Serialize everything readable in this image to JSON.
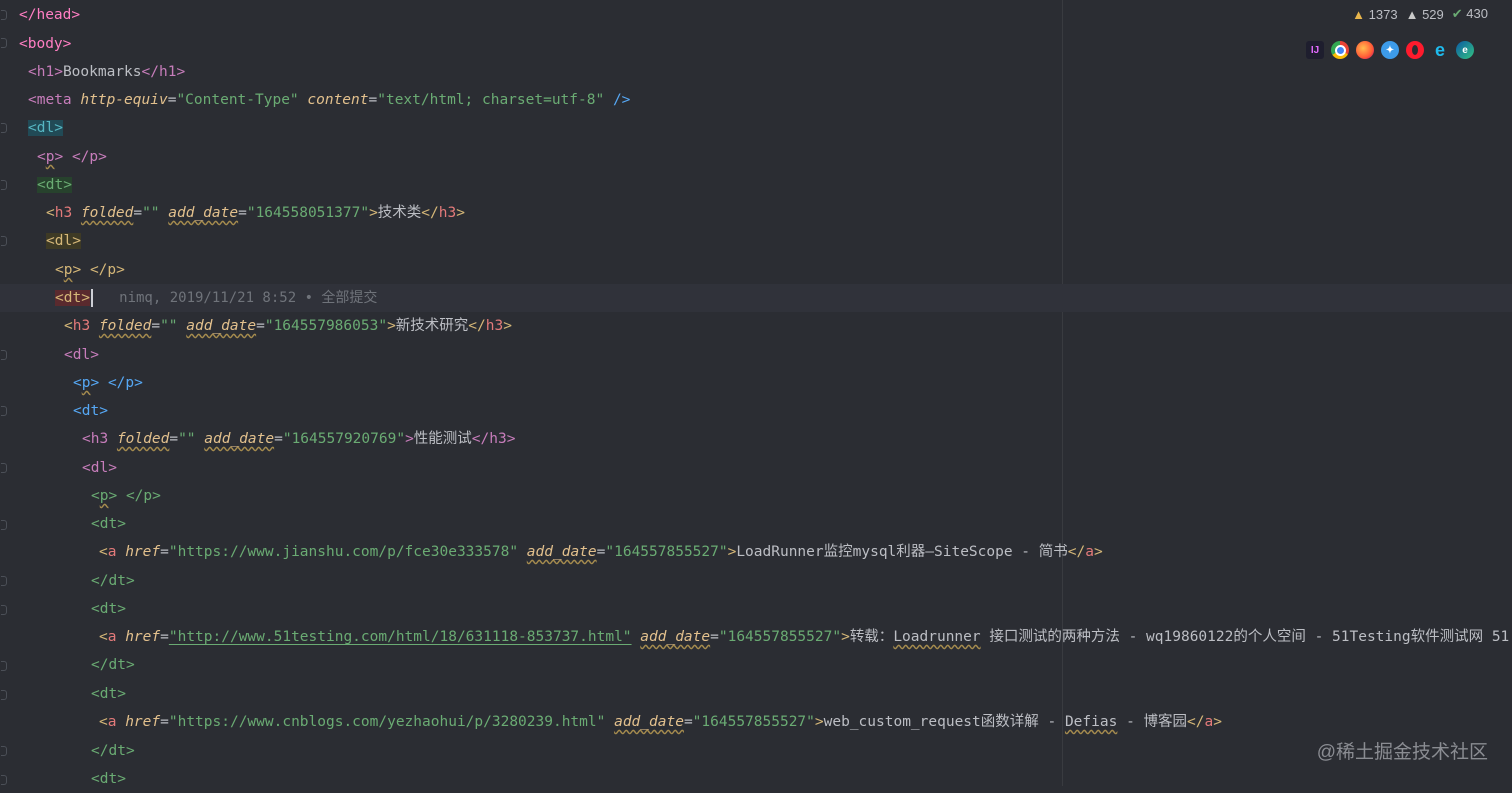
{
  "inspections": {
    "warnings": "1373",
    "weak_warnings": "529",
    "typos": "430"
  },
  "browsers": [
    "intellij-icon",
    "chrome-icon",
    "firefox-icon",
    "safari-icon",
    "opera-icon",
    "ie-icon",
    "edge-icon"
  ],
  "blame": "nimq, 2019/11/21 8:52 • 全部提交",
  "watermark": "@稀土掘金技术社区",
  "code": {
    "l1_name": "head",
    "l2_name": "body",
    "l3_name": "h1",
    "l3_text": "Bookmarks",
    "l4_name": "meta",
    "l4_a1": "http-equiv",
    "l4_v1": "\"Content-Type\"",
    "l4_a2": "content",
    "l4_v2": "\"text/html; charset=utf-8\"",
    "l5_name": "dl",
    "l6_name": "p",
    "l7_name": "dt",
    "l8_name": "h3",
    "l8_a1": "folded",
    "l8_v1": "\"\"",
    "l8_a2": "add_date",
    "l8_v2": "\"164558051377\"",
    "l8_text": "技术类",
    "l9_name": "dl",
    "l10_name": "p",
    "l11_name": "dt",
    "l12_name": "h3",
    "l12_a1": "folded",
    "l12_v1": "\"\"",
    "l12_a2": "add_date",
    "l12_v2": "\"164557986053\"",
    "l12_text": "新技术研究",
    "l13_name": "dl",
    "l14_name": "p",
    "l15_name": "dt",
    "l16_name": "h3",
    "l16_a1": "folded",
    "l16_v1": "\"\"",
    "l16_a2": "add_date",
    "l16_v2": "\"164557920769\"",
    "l16_text": "性能测试",
    "l17_name": "dl",
    "l18_name": "p",
    "l19_name": "dt",
    "l20_name": "a",
    "l20_a1": "href",
    "l20_v1": "\"https://www.jianshu.com/p/fce30e333578\"",
    "l20_a2": "add_date",
    "l20_v2": "\"164557855527\"",
    "l20_text": "LoadRunner监控mysql利器—SiteScope - 简书",
    "l21_name": "dt",
    "l22_name": "dt",
    "l23_name": "a",
    "l23_a1": "href",
    "l23_v1": "\"http://www.51testing.com/html/18/631118-853737.html\"",
    "l23_a2": "add_date",
    "l23_v2": "\"164557855527\"",
    "l23_text1": "转载：",
    "l23_text2": "Loadrunner",
    "l23_text3": " 接口测试的两种方法 - wq19860122的个人空间 - 51Testing软件测试网 51",
    "l24_name": "dt",
    "l25_name": "dt",
    "l26_name": "a",
    "l26_a1": "href",
    "l26_v1": "\"https://www.cnblogs.com/yezhaohui/p/3280239.html\"",
    "l26_a2": "add_date",
    "l26_v2": "\"164557855527\"",
    "l26_text1": "web_custom_request函数详解 - ",
    "l26_text2": "Defias",
    "l26_text3": " - 博客园",
    "l27_name": "dt",
    "l28_name": "dt"
  }
}
